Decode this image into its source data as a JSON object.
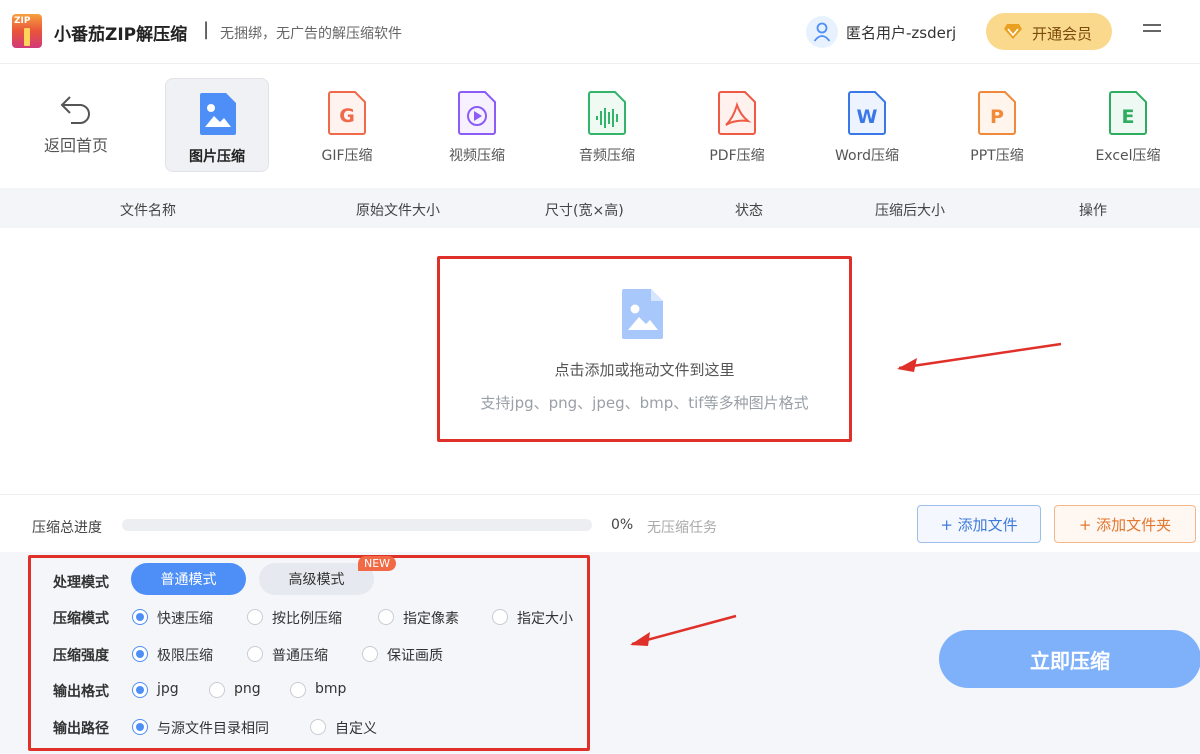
{
  "header": {
    "app_title": "小番茄ZIP解压缩",
    "separator": "|",
    "subtitle": "无捆绑，无广告的解压缩软件",
    "user_name": "匿名用户-zsderj",
    "vip_label": "开通会员",
    "logo_text": "ZIP"
  },
  "toolbar": {
    "back_label": "返回首页",
    "tools": [
      {
        "label": "图片压缩",
        "icon": "image-icon",
        "color": "#4d8ff7",
        "active": true
      },
      {
        "label": "GIF压缩",
        "icon": "gif-icon",
        "color": "#ef6a4b",
        "active": false
      },
      {
        "label": "视频压缩",
        "icon": "video-icon",
        "color": "#8b5cf6",
        "active": false
      },
      {
        "label": "音频压缩",
        "icon": "audio-icon",
        "color": "#34b36a",
        "active": false
      },
      {
        "label": "PDF压缩",
        "icon": "pdf-icon",
        "color": "#ef5a45",
        "active": false
      },
      {
        "label": "Word压缩",
        "icon": "word-icon",
        "color": "#3b78e7",
        "active": false
      },
      {
        "label": "PPT压缩",
        "icon": "ppt-icon",
        "color": "#f08a3a",
        "active": false
      },
      {
        "label": "Excel压缩",
        "icon": "excel-icon",
        "color": "#2eac5f",
        "active": false
      }
    ]
  },
  "table": {
    "columns": [
      "文件名称",
      "原始文件大小",
      "尺寸(宽×高)",
      "状态",
      "压缩后大小",
      "操作"
    ]
  },
  "dropzone": {
    "main_text": "点击添加或拖动文件到这里",
    "sub_text": "支持jpg、png、jpeg、bmp、tif等多种图片格式"
  },
  "progress": {
    "label": "压缩总进度",
    "percent_text": "0%",
    "percent_value": 0,
    "status": "无压缩任务",
    "add_file": "+ 添加文件",
    "add_folder": "+ 添加文件夹"
  },
  "settings": {
    "process_mode_label": "处理模式",
    "mode_normal": "普通模式",
    "mode_advanced": "高级模式",
    "new_badge": "NEW",
    "compress_mode_label": "压缩模式",
    "compress_mode_options": [
      "快速压缩",
      "按比例压缩",
      "指定像素",
      "指定大小"
    ],
    "strength_label": "压缩强度",
    "strength_options": [
      "极限压缩",
      "普通压缩",
      "保证画质"
    ],
    "format_label": "输出格式",
    "format_options": [
      "jpg",
      "png",
      "bmp"
    ],
    "path_label": "输出路径",
    "path_options": [
      "与源文件目录相同",
      "自定义"
    ]
  },
  "start_button": "立即压缩",
  "colors": {
    "accent": "#4d8ff7",
    "highlight_red": "#e0302a",
    "vip_gold": "#fbd98c"
  }
}
